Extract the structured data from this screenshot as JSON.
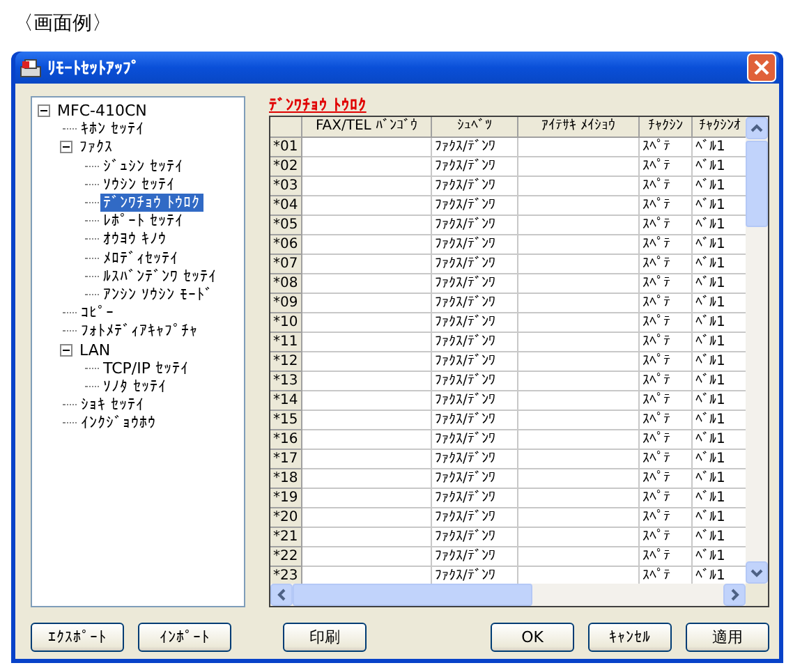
{
  "caption": "〈画面例〉",
  "window": {
    "title": "ﾘﾓｰﾄｾｯﾄｱｯﾌﾟ"
  },
  "tree": [
    {
      "label": "MFC-410CN",
      "selected": false,
      "expanded": true,
      "children": [
        {
          "label": "ｷﾎﾝ ｾｯﾃｲ",
          "selected": false
        },
        {
          "label": "ﾌｧｸｽ",
          "selected": false,
          "expanded": true,
          "children": [
            {
              "label": "ｼﾞｭｼﾝ ｾｯﾃｲ",
              "selected": false
            },
            {
              "label": "ｿｳｼﾝ ｾｯﾃｲ",
              "selected": false
            },
            {
              "label": "ﾃﾞﾝﾜﾁｮｳ ﾄｳﾛｸ",
              "selected": true
            },
            {
              "label": "ﾚﾎﾟｰﾄ ｾｯﾃｲ",
              "selected": false
            },
            {
              "label": "ｵｳﾖｳ ｷﾉｳ",
              "selected": false
            },
            {
              "label": "ﾒﾛﾃﾞｨｾｯﾃｲ",
              "selected": false
            },
            {
              "label": "ﾙｽﾊﾞﾝﾃﾞﾝﾜ ｾｯﾃｲ",
              "selected": false
            },
            {
              "label": "ｱﾝｼﾝ ｿｳｼﾝ ﾓｰﾄﾞ",
              "selected": false
            }
          ]
        },
        {
          "label": "ｺﾋﾟｰ",
          "selected": false
        },
        {
          "label": "ﾌｫﾄﾒﾃﾞｨｱｷｬﾌﾟﾁｬ",
          "selected": false
        },
        {
          "label": "LAN",
          "selected": false,
          "expanded": true,
          "children": [
            {
              "label": "TCP/IP ｾｯﾃｲ",
              "selected": false
            },
            {
              "label": "ｿﾉﾀ ｾｯﾃｲ",
              "selected": false
            }
          ]
        },
        {
          "label": "ｼｮｷ ｾｯﾃｲ",
          "selected": false
        },
        {
          "label": "ｲﾝｸｼﾞｮｳﾎｳ",
          "selected": false
        }
      ]
    }
  ],
  "panel_title": "ﾃﾞﾝﾜﾁｮｳ ﾄｳﾛｸ",
  "table": {
    "columns": [
      "FAX/TEL ﾊﾞﾝｺﾞｳ",
      "ｼｭﾍﾞﾂ",
      "ｱｲﾃｻｷ ﾒｲｼｮｳ",
      "ﾁｬｸｼﾝ",
      "ﾁｬｸｼﾝｵ"
    ],
    "rows": [
      {
        "label": "*01",
        "type": "ﾌｧｸｽ/ﾃﾞﾝﾜ",
        "ring": "ｽﾍﾟﾃ",
        "tone": "ﾍﾞﾙ1"
      },
      {
        "label": "*02",
        "type": "ﾌｧｸｽ/ﾃﾞﾝﾜ",
        "ring": "ｽﾍﾟﾃ",
        "tone": "ﾍﾞﾙ1"
      },
      {
        "label": "*03",
        "type": "ﾌｧｸｽ/ﾃﾞﾝﾜ",
        "ring": "ｽﾍﾟﾃ",
        "tone": "ﾍﾞﾙ1"
      },
      {
        "label": "*04",
        "type": "ﾌｧｸｽ/ﾃﾞﾝﾜ",
        "ring": "ｽﾍﾟﾃ",
        "tone": "ﾍﾞﾙ1"
      },
      {
        "label": "*05",
        "type": "ﾌｧｸｽ/ﾃﾞﾝﾜ",
        "ring": "ｽﾍﾟﾃ",
        "tone": "ﾍﾞﾙ1"
      },
      {
        "label": "*06",
        "type": "ﾌｧｸｽ/ﾃﾞﾝﾜ",
        "ring": "ｽﾍﾟﾃ",
        "tone": "ﾍﾞﾙ1"
      },
      {
        "label": "*07",
        "type": "ﾌｧｸｽ/ﾃﾞﾝﾜ",
        "ring": "ｽﾍﾟﾃ",
        "tone": "ﾍﾞﾙ1"
      },
      {
        "label": "*08",
        "type": "ﾌｧｸｽ/ﾃﾞﾝﾜ",
        "ring": "ｽﾍﾟﾃ",
        "tone": "ﾍﾞﾙ1"
      },
      {
        "label": "*09",
        "type": "ﾌｧｸｽ/ﾃﾞﾝﾜ",
        "ring": "ｽﾍﾟﾃ",
        "tone": "ﾍﾞﾙ1"
      },
      {
        "label": "*10",
        "type": "ﾌｧｸｽ/ﾃﾞﾝﾜ",
        "ring": "ｽﾍﾟﾃ",
        "tone": "ﾍﾞﾙ1"
      },
      {
        "label": "*11",
        "type": "ﾌｧｸｽ/ﾃﾞﾝﾜ",
        "ring": "ｽﾍﾟﾃ",
        "tone": "ﾍﾞﾙ1"
      },
      {
        "label": "*12",
        "type": "ﾌｧｸｽ/ﾃﾞﾝﾜ",
        "ring": "ｽﾍﾟﾃ",
        "tone": "ﾍﾞﾙ1"
      },
      {
        "label": "*13",
        "type": "ﾌｧｸｽ/ﾃﾞﾝﾜ",
        "ring": "ｽﾍﾟﾃ",
        "tone": "ﾍﾞﾙ1"
      },
      {
        "label": "*14",
        "type": "ﾌｧｸｽ/ﾃﾞﾝﾜ",
        "ring": "ｽﾍﾟﾃ",
        "tone": "ﾍﾞﾙ1"
      },
      {
        "label": "*15",
        "type": "ﾌｧｸｽ/ﾃﾞﾝﾜ",
        "ring": "ｽﾍﾟﾃ",
        "tone": "ﾍﾞﾙ1"
      },
      {
        "label": "*16",
        "type": "ﾌｧｸｽ/ﾃﾞﾝﾜ",
        "ring": "ｽﾍﾟﾃ",
        "tone": "ﾍﾞﾙ1"
      },
      {
        "label": "*17",
        "type": "ﾌｧｸｽ/ﾃﾞﾝﾜ",
        "ring": "ｽﾍﾟﾃ",
        "tone": "ﾍﾞﾙ1"
      },
      {
        "label": "*18",
        "type": "ﾌｧｸｽ/ﾃﾞﾝﾜ",
        "ring": "ｽﾍﾟﾃ",
        "tone": "ﾍﾞﾙ1"
      },
      {
        "label": "*19",
        "type": "ﾌｧｸｽ/ﾃﾞﾝﾜ",
        "ring": "ｽﾍﾟﾃ",
        "tone": "ﾍﾞﾙ1"
      },
      {
        "label": "*20",
        "type": "ﾌｧｸｽ/ﾃﾞﾝﾜ",
        "ring": "ｽﾍﾟﾃ",
        "tone": "ﾍﾞﾙ1"
      },
      {
        "label": "*21",
        "type": "ﾌｧｸｽ/ﾃﾞﾝﾜ",
        "ring": "ｽﾍﾟﾃ",
        "tone": "ﾍﾞﾙ1"
      },
      {
        "label": "*22",
        "type": "ﾌｧｸｽ/ﾃﾞﾝﾜ",
        "ring": "ｽﾍﾟﾃ",
        "tone": "ﾍﾞﾙ1"
      },
      {
        "label": "*23",
        "type": "ﾌｧｸｽ/ﾃﾞﾝﾜ",
        "ring": "ｽﾍﾟﾃ",
        "tone": "ﾍﾞﾙ1"
      }
    ]
  },
  "left_buttons": [
    "ｴｸｽﾎﾟｰﾄ",
    "ｲﾝﾎﾟｰﾄ"
  ],
  "print_button": "印刷",
  "right_buttons": [
    "OK",
    "ｷｬﾝｾﾙ",
    "適用"
  ]
}
